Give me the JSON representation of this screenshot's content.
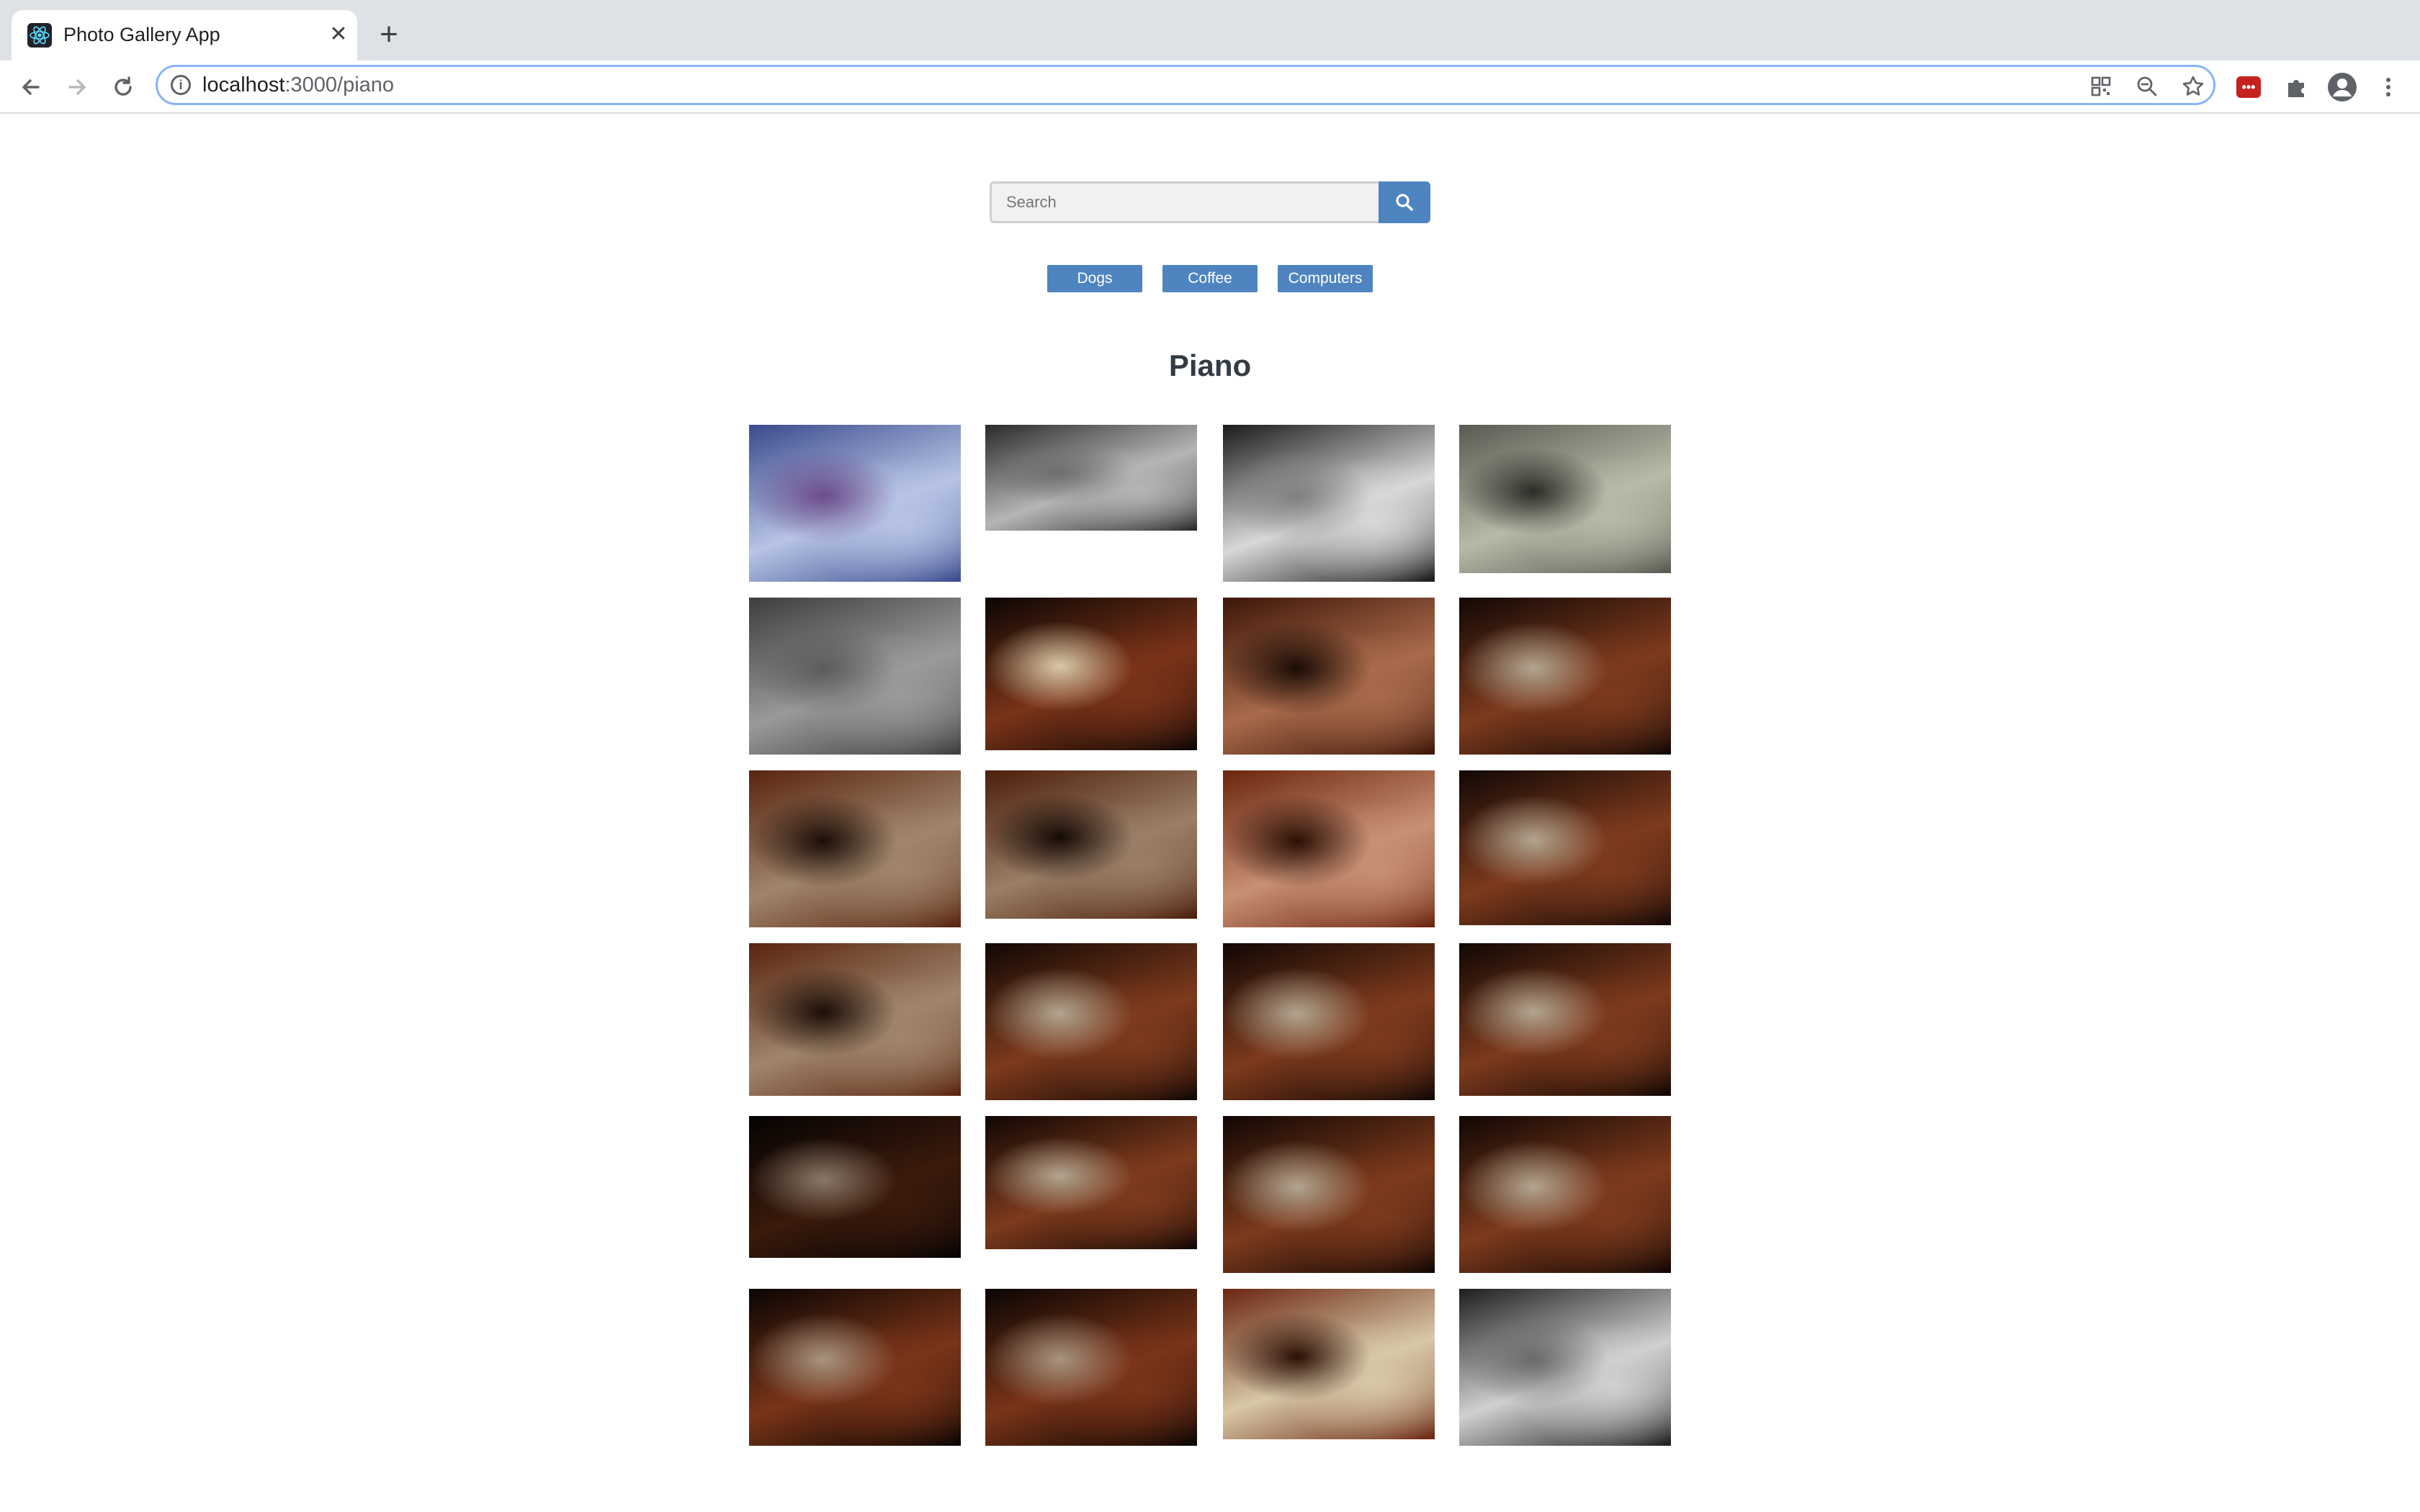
{
  "browser": {
    "tab_title": "Photo Gallery App",
    "close_glyph": "✕",
    "new_tab_glyph": "+",
    "url_host": "localhost",
    "url_path": ":3000/piano",
    "info_glyph": "i"
  },
  "search": {
    "placeholder": "Search",
    "button_icon": "search-icon"
  },
  "topics": [
    "Dogs",
    "Coffee",
    "Computers"
  ],
  "gallery": {
    "title": "Piano",
    "photos": [
      {
        "subject": "girl-with-flowers-and-piano",
        "palette": [
          "#3b4a8c",
          "#b7c4e6",
          "#6b4c8a"
        ],
        "aspect": 0.74
      },
      {
        "subject": "piano-hammers-close-up",
        "palette": [
          "#2a2a2a",
          "#b5b5b5",
          "#6e6e6e"
        ],
        "aspect": 0.5
      },
      {
        "subject": "band-on-stage-bw",
        "palette": [
          "#1a1a1a",
          "#d8d8d8",
          "#808080"
        ],
        "aspect": 0.74
      },
      {
        "subject": "two-men-at-piano-sepia",
        "palette": [
          "#5a5a52",
          "#b9b9a8",
          "#2c2c28"
        ],
        "aspect": 0.7
      },
      {
        "subject": "flower-monochrome",
        "palette": [
          "#3d3d3d",
          "#9a9a9a",
          "#5c5c5c"
        ],
        "aspect": 0.74
      },
      {
        "subject": "square-piano-empty",
        "palette": [
          "#0c0604",
          "#7a3318",
          "#d9c9a8"
        ],
        "aspect": 0.72
      },
      {
        "subject": "woman-holding-tablet",
        "palette": [
          "#3e1608",
          "#a86a4a",
          "#1b0c06"
        ],
        "aspect": 0.74
      },
      {
        "subject": "woman-seated-at-piano",
        "palette": [
          "#120806",
          "#7d3a1c",
          "#b2a590"
        ],
        "aspect": 0.74
      },
      {
        "subject": "woman-smiling-at-piano",
        "palette": [
          "#5a2410",
          "#a0856b",
          "#1a0d07"
        ],
        "aspect": 0.74
      },
      {
        "subject": "woman-smiling-at-piano",
        "palette": [
          "#4d1e0c",
          "#9a7e66",
          "#140a05"
        ],
        "aspect": 0.7
      },
      {
        "subject": "woman-portrait-glasses",
        "palette": [
          "#6b250e",
          "#c89074",
          "#2a0f05"
        ],
        "aspect": 0.74
      },
      {
        "subject": "woman-seated-at-piano",
        "palette": [
          "#120806",
          "#7d3a1c",
          "#b2a590"
        ],
        "aspect": 0.73
      },
      {
        "subject": "woman-laughing-at-piano",
        "palette": [
          "#5a2410",
          "#a0856b",
          "#1a0d07"
        ],
        "aspect": 0.72
      },
      {
        "subject": "woman-playing-piano",
        "palette": [
          "#110704",
          "#7d3a1c",
          "#b2a590"
        ],
        "aspect": 0.74
      },
      {
        "subject": "woman-playing-piano",
        "palette": [
          "#110704",
          "#7d3a1c",
          "#b2a590"
        ],
        "aspect": 0.74
      },
      {
        "subject": "woman-playing-piano",
        "palette": [
          "#110704",
          "#7d3a1c",
          "#b2a590"
        ],
        "aspect": 0.72
      },
      {
        "subject": "woman-at-piano-dark-stage",
        "palette": [
          "#050302",
          "#3a1a0c",
          "#8a7868"
        ],
        "aspect": 0.67
      },
      {
        "subject": "woman-playing-piano",
        "palette": [
          "#110704",
          "#7d3a1c",
          "#b2a590"
        ],
        "aspect": 0.63
      },
      {
        "subject": "woman-playing-piano",
        "palette": [
          "#110704",
          "#7d3a1c",
          "#b2a590"
        ],
        "aspect": 0.74
      },
      {
        "subject": "woman-playing-piano",
        "palette": [
          "#110704",
          "#7d3a1c",
          "#b2a590"
        ],
        "aspect": 0.74
      },
      {
        "subject": "woman-standing-by-piano",
        "palette": [
          "#0a0503",
          "#7a3418",
          "#a89480"
        ],
        "aspect": 0.74
      },
      {
        "subject": "woman-standing-by-piano",
        "palette": [
          "#0a0503",
          "#7a3418",
          "#a89480"
        ],
        "aspect": 0.74
      },
      {
        "subject": "hands-on-keys-sheet-music",
        "palette": [
          "#6b2610",
          "#d8c8a8",
          "#2c0f05"
        ],
        "aspect": 0.71
      },
      {
        "subject": "hands-on-keys-bw",
        "palette": [
          "#1e1e1e",
          "#d0d0d0",
          "#6a6a6a"
        ],
        "aspect": 0.74
      }
    ]
  }
}
